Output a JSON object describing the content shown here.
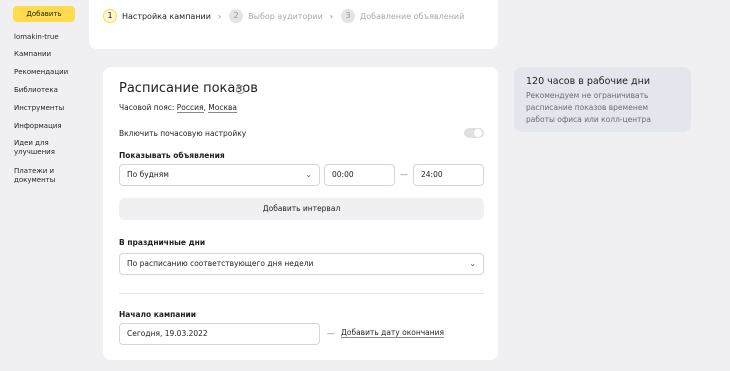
{
  "sidebar": {
    "add_button": "Добавить",
    "items": [
      {
        "label": "lomakin-true"
      },
      {
        "label": "Кампании"
      },
      {
        "label": "Рекомендации"
      },
      {
        "label": "Библиотека"
      },
      {
        "label": "Инструменты"
      },
      {
        "label": "Информация"
      },
      {
        "label": "Идеи для улучшения"
      },
      {
        "label": "Платежи и документы"
      }
    ]
  },
  "stepper": {
    "steps": [
      {
        "number": "1",
        "label": "Настройка кампании",
        "active": true
      },
      {
        "number": "2",
        "label": "Выбор аудитории",
        "active": false
      },
      {
        "number": "3",
        "label": "Добавление объявлений",
        "active": false
      }
    ]
  },
  "schedule": {
    "title": "Расписание показов",
    "help_icon": "?",
    "timezone_label": "Часовой пояс:",
    "timezone_country": "Россия",
    "timezone_separator": ",",
    "timezone_city": "Москва",
    "hourly_toggle_label": "Включить почасовую настройку",
    "hourly_toggle_on": false,
    "show_ads_label": "Показывать объявления",
    "days_select_value": "По будням",
    "time_from": "00:00",
    "time_dash": "—",
    "time_to": "24:00",
    "add_interval_button": "Добавить интервал",
    "holidays_label": "В праздничные дни",
    "holidays_select_value": "По расписанию соответствующего дня недели",
    "start_label": "Начало кампании",
    "start_value": "Сегодня, 19.03.2022",
    "end_dash": "—",
    "add_end_link": "Добавить дату окончания"
  },
  "info_card": {
    "title": "120 часов в рабочие дни",
    "text": "Рекомендуем не ограничивать расписание показов временем работы офиса или колл-центра"
  },
  "icons": {
    "chevron_right": "›",
    "chevron_down": "⌄"
  },
  "colors": {
    "accent_yellow": "#ffdb4d",
    "background": "#f0f0f2",
    "info_card_bg": "#e4e6ee"
  }
}
